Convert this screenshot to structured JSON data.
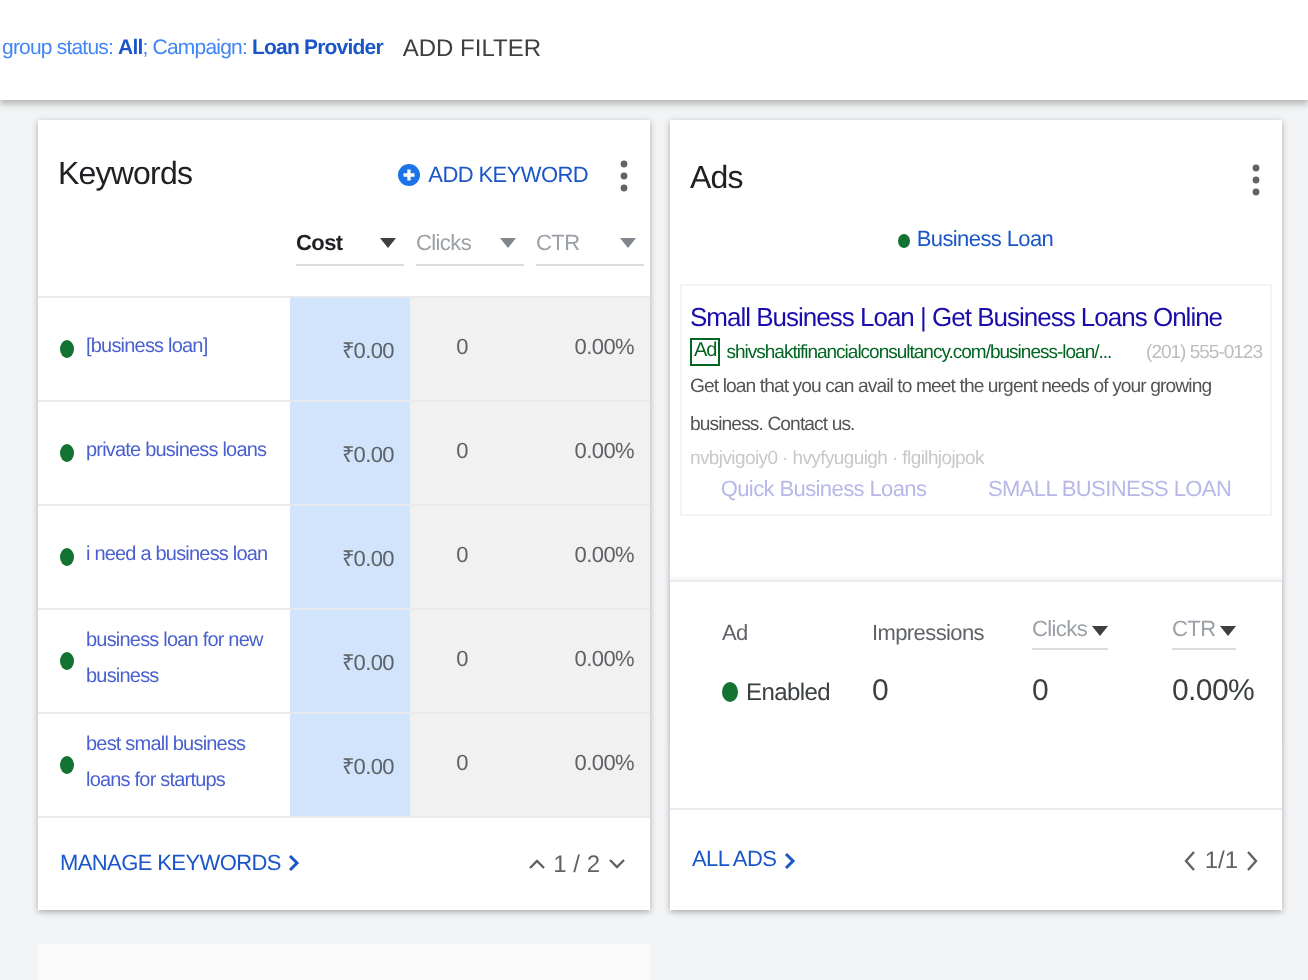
{
  "filter_bar": {
    "filter_text": "group status: **All**; Campaign: **Loan Provider**",
    "add_filter": "ADD FILTER"
  },
  "keywords_card": {
    "title": "Keywords",
    "add_button": "ADD KEYWORD",
    "columns": [
      {
        "label": "Cost",
        "selected": true
      },
      {
        "label": "Clicks",
        "selected": false
      },
      {
        "label": "CTR",
        "selected": false
      }
    ],
    "rows": [
      {
        "keyword": "[business loan]",
        "color": "#137333",
        "cost": "₹0.00",
        "clicks": "0",
        "ctr": "0.00%"
      },
      {
        "keyword": "private business loans",
        "color": "#137333",
        "cost": "₹0.00",
        "clicks": "0",
        "ctr": "0.00%"
      },
      {
        "keyword": "i need a business loan",
        "color": "#137333",
        "cost": "₹0.00",
        "clicks": "0",
        "ctr": "0.00%"
      },
      {
        "keyword": "business loan for new business",
        "color": "#137333",
        "cost": "₹0.00",
        "clicks": "0",
        "ctr": "0.00%"
      },
      {
        "keyword": "best small business loans for startups",
        "color": "#137333",
        "cost": "₹0.00",
        "clicks": "0",
        "ctr": "0.00%"
      }
    ],
    "footer_link": "MANAGE KEYWORDS",
    "pager": "1 / 2"
  },
  "ads_card": {
    "title": "Ads",
    "ad_group": {
      "name": "Business Loan",
      "color": "#137333"
    },
    "ad": {
      "headline": "Small Business Loan | Get Business Loans Online",
      "badge": "Ad",
      "url": "shivshaktifinancialconsultancy.com/business-loan/...",
      "phone": "(201) 555-0123",
      "description": "Get loan that you can avail to meet the urgent needs of your growing business. Contact us.",
      "path_text": "nvbjvigoiy0 · hvyfyuguigh · flgilhjojpok",
      "sitelinks": [
        "Quick Business Loans",
        "SMALL BUSINESS LOAN"
      ]
    },
    "stat_columns": [
      {
        "label": "Ad",
        "kind": "plain"
      },
      {
        "label": "Impressions",
        "kind": "plain"
      },
      {
        "label": "Clicks",
        "kind": "sortable"
      },
      {
        "label": "CTR",
        "kind": "sortable"
      }
    ],
    "status": {
      "label": "Enabled",
      "color": "#137333"
    },
    "stat_values": [
      "0",
      "0",
      "0.00%"
    ],
    "footer_link": "ALL ADS",
    "pager": "1/1"
  }
}
